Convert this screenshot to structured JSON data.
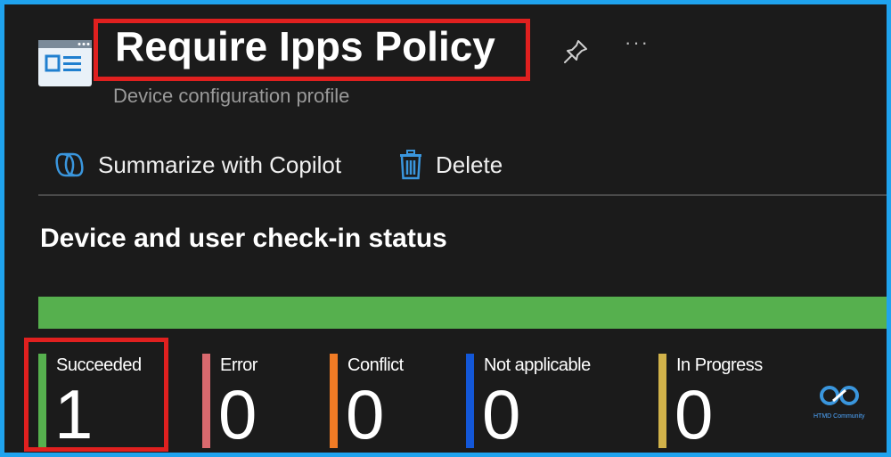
{
  "header": {
    "title": "Require Ipps Policy",
    "subtitle": "Device configuration profile",
    "more_label": "···"
  },
  "toolbar": {
    "summarize_label": "Summarize with Copilot",
    "delete_label": "Delete"
  },
  "section": {
    "title": "Device and user check-in status"
  },
  "progress": {
    "succeeded_fraction": 1.0,
    "color": "#56b04e"
  },
  "stats": [
    {
      "label": "Succeeded",
      "value": "1",
      "color": "#56b04e"
    },
    {
      "label": "Error",
      "value": "0",
      "color": "#d9696e"
    },
    {
      "label": "Conflict",
      "value": "0",
      "color": "#f07b25"
    },
    {
      "label": "Not applicable",
      "value": "0",
      "color": "#1357d8"
    },
    {
      "label": "In Progress",
      "value": "0",
      "color": "#d1b24a"
    }
  ],
  "watermark": {
    "text": "HTMD Community"
  },
  "icons": [
    "profile-document-icon",
    "pin-icon",
    "more-icon",
    "copilot-icon",
    "trash-icon",
    "htmd-logo-icon"
  ],
  "colors": {
    "highlight": "#e0201f",
    "accent": "#1fa3ee",
    "background": "#1b1b1b"
  }
}
